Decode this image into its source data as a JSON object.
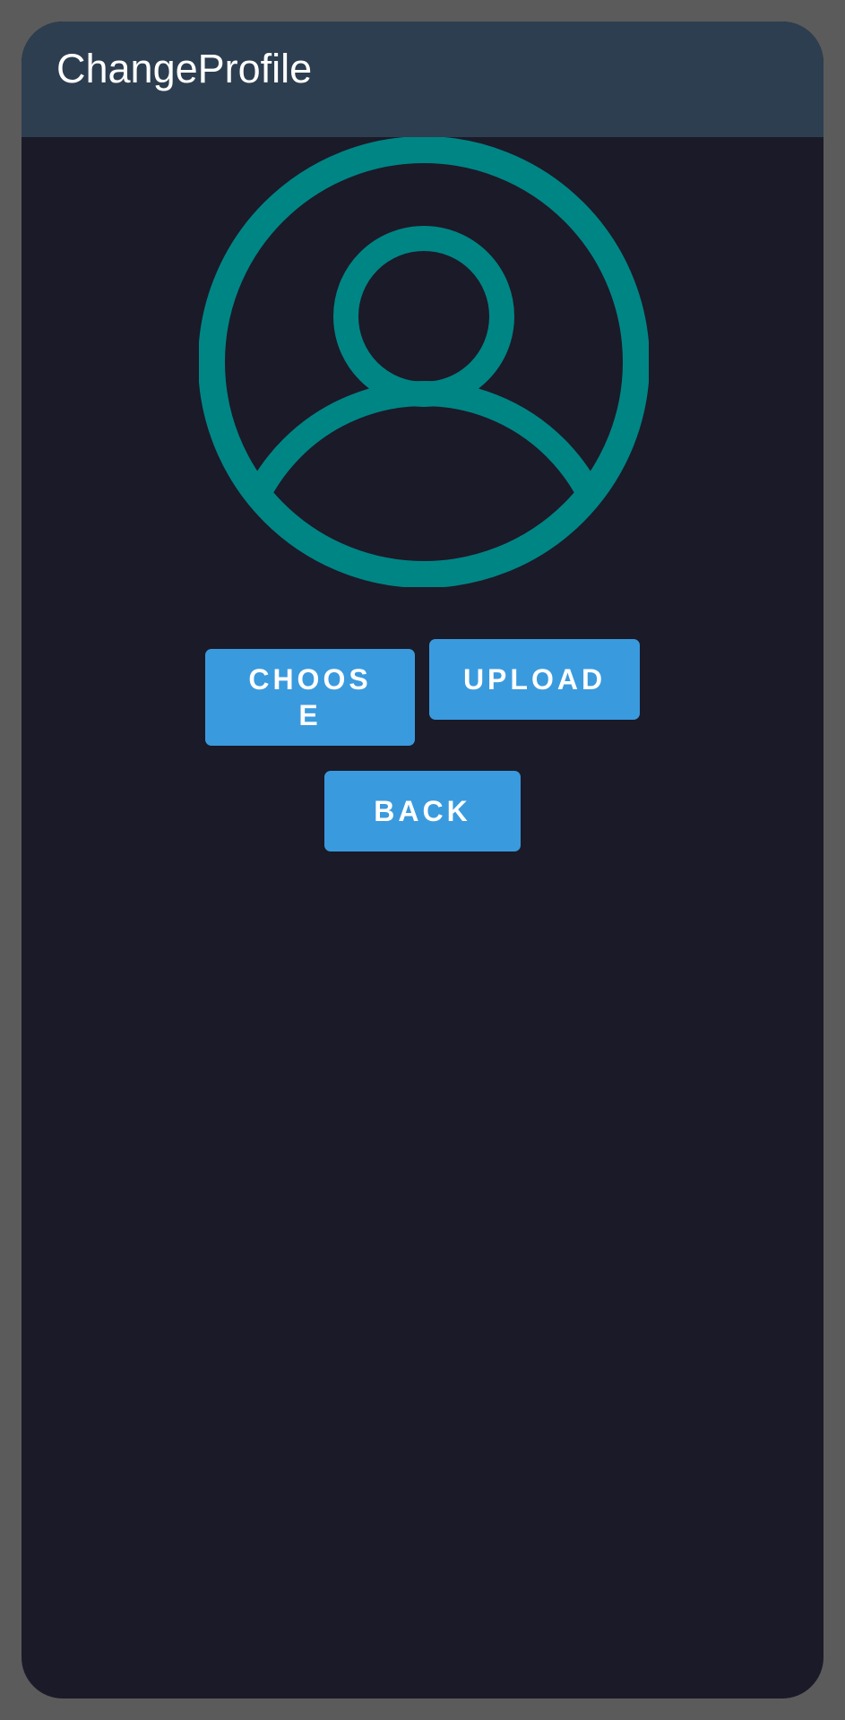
{
  "app_bar": {
    "title": "ChangeProfile"
  },
  "avatar": {
    "icon": "account-circle-icon",
    "color": "#008585"
  },
  "buttons": {
    "choose_label": "CHOOSE",
    "upload_label": "UPLOAD",
    "back_label": "BACK"
  },
  "colors": {
    "app_bar_bg": "#2d3e50",
    "screen_bg": "#1b1a28",
    "button_bg": "#3a9ade",
    "frame": "#5b5b5b"
  }
}
